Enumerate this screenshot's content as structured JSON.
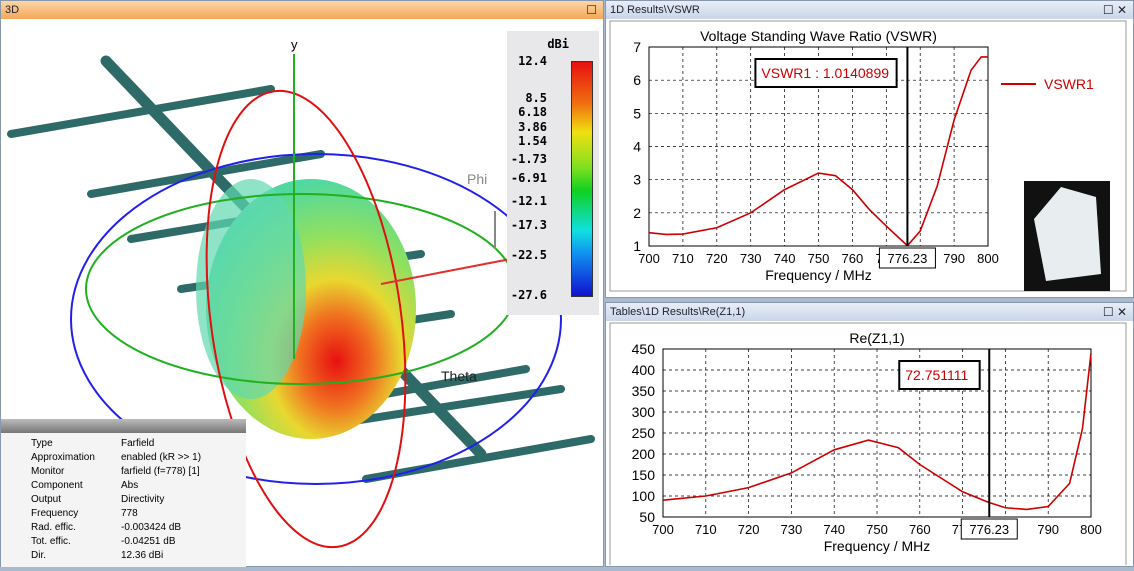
{
  "view3d": {
    "title": "3D",
    "axes": {
      "y": "y",
      "phi": "Phi",
      "theta": "Theta"
    },
    "colorbar": {
      "unit": "dBi",
      "ticks": [
        "12.4",
        "8.5",
        "6.18",
        "3.86",
        "1.54",
        "-1.73",
        "-6.91",
        "-12.1",
        "-17.3",
        "-22.5",
        "-27.6"
      ]
    },
    "info": [
      [
        "Type",
        "Farfield"
      ],
      [
        "Approximation",
        "enabled (kR >> 1)"
      ],
      [
        "Monitor",
        "farfield (f=778) [1]"
      ],
      [
        "Component",
        "Abs"
      ],
      [
        "Output",
        "Directivity"
      ],
      [
        "Frequency",
        "778"
      ],
      [
        "Rad. effic.",
        "-0.003424 dB"
      ],
      [
        "Tot. effic.",
        "-0.04251 dB"
      ],
      [
        "Dir.",
        "12.36 dBi"
      ]
    ]
  },
  "vswr_window": {
    "title": "1D Results\\VSWR",
    "maximize": "☐",
    "close": "✕"
  },
  "re_window": {
    "title": "Tables\\1D Results\\Re(Z1,1)",
    "maximize": "☐",
    "close": "✕"
  },
  "chart_data": [
    {
      "type": "line",
      "title": "Voltage Standing Wave Ratio (VSWR)",
      "xlabel": "Frequency / MHz",
      "ylabel": "",
      "xlim": [
        700,
        800
      ],
      "ylim": [
        1,
        7
      ],
      "xticks": [
        "700",
        "710",
        "720",
        "730",
        "740",
        "750",
        "760",
        "770",
        "780",
        "790",
        "800"
      ],
      "yticks": [
        "1",
        "2",
        "3",
        "4",
        "5",
        "6",
        "7"
      ],
      "series": [
        {
          "name": "VSWR1",
          "color": "#cc0000",
          "x": [
            700,
            705,
            710,
            720,
            730,
            740,
            750,
            755,
            760,
            765,
            770,
            776.23,
            780,
            785,
            790,
            795,
            798,
            800
          ],
          "y": [
            1.4,
            1.35,
            1.36,
            1.55,
            2.0,
            2.7,
            3.2,
            3.12,
            2.7,
            2.1,
            1.6,
            1.01,
            1.45,
            2.8,
            4.8,
            6.3,
            6.7,
            6.7
          ]
        }
      ],
      "marker": {
        "x": "776.23",
        "label": "VSWR1 : 1.0140899"
      },
      "legend": "top-right",
      "grid": true
    },
    {
      "type": "line",
      "title": "Re(Z1,1)",
      "xlabel": "Frequency / MHz",
      "ylabel": "",
      "xlim": [
        700,
        800
      ],
      "ylim": [
        50,
        450
      ],
      "xticks": [
        "700",
        "710",
        "720",
        "730",
        "740",
        "750",
        "760",
        "770",
        "780",
        "790",
        "800"
      ],
      "yticks": [
        "50",
        "100",
        "150",
        "200",
        "250",
        "300",
        "350",
        "400",
        "450"
      ],
      "series": [
        {
          "name": "Re(Z1,1)",
          "color": "#cc0000",
          "x": [
            700,
            710,
            720,
            730,
            740,
            748,
            755,
            760,
            770,
            776,
            780,
            785,
            790,
            795,
            798,
            800
          ],
          "y": [
            90,
            100,
            120,
            155,
            210,
            233,
            215,
            175,
            110,
            85,
            72,
            68,
            75,
            130,
            260,
            440
          ]
        }
      ],
      "marker": {
        "x": "776.23",
        "label": "72.751111"
      },
      "grid": true
    }
  ]
}
